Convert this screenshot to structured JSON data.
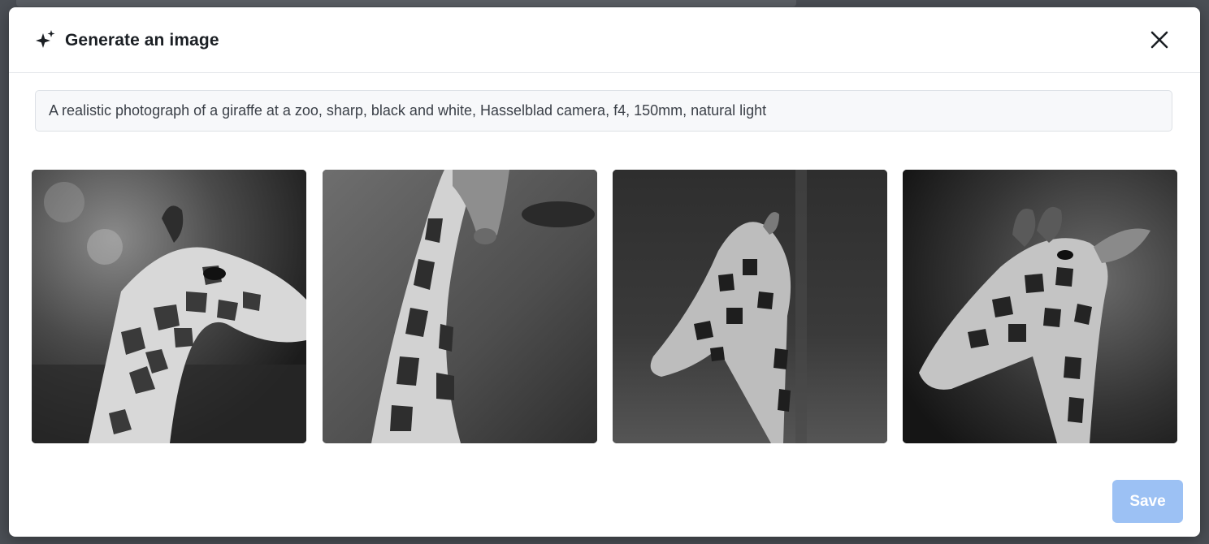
{
  "dialog": {
    "title": "Generate an image",
    "title_icon": "sparkles-icon",
    "close_icon": "close-icon"
  },
  "prompt": {
    "value": "A realistic photograph of a giraffe at a zoo, sharp, black and white, Hasselblad camera, f4, 150mm, natural light"
  },
  "images": [
    {
      "subject": "giraffe head in profile facing right, black and white"
    },
    {
      "subject": "giraffe long neck with head bending down, black and white"
    },
    {
      "subject": "giraffe head looking left against dark background, black and white"
    },
    {
      "subject": "giraffe head close-up looking left, black and white"
    }
  ],
  "footer": {
    "save_label": "Save"
  },
  "colors": {
    "save_button_bg": "#9cc1f4",
    "modal_bg": "#ffffff",
    "overlay_bg": "#4b4f55"
  }
}
